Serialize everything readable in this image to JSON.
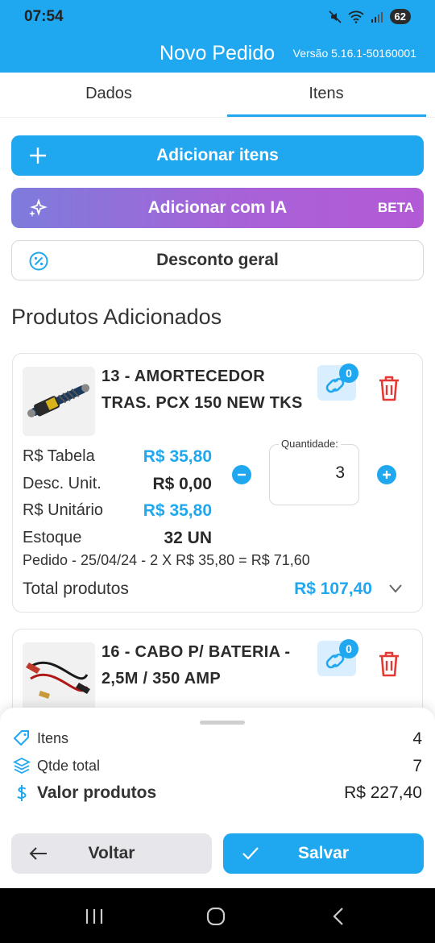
{
  "status": {
    "time": "07:54",
    "battery": "62"
  },
  "app": {
    "title": "Novo Pedido",
    "version": "Versão 5.16.1-50160001"
  },
  "tabs": [
    {
      "label": "Dados"
    },
    {
      "label": "Itens"
    }
  ],
  "actions": {
    "add_items": "Adicionar itens",
    "add_ai": "Adicionar com IA",
    "beta": "BETA",
    "discount": "Desconto geral"
  },
  "section_title": "Produtos Adicionados",
  "products": [
    {
      "name": "13 - AMORTECEDOR TRAS. PCX 150 NEW TKS",
      "link_count": "0",
      "rows": [
        {
          "label": "R$ Tabela",
          "value": "R$ 35,80"
        },
        {
          "label": "Desc. Unit.",
          "value": "R$ 0,00"
        },
        {
          "label": "R$ Unitário",
          "value": "R$ 35,80"
        },
        {
          "label": "Estoque",
          "value": "32 UN"
        }
      ],
      "quantity_label": "Quantidade:",
      "quantity": "3",
      "history": "Pedido - 25/04/24 - 2 X R$ 35,80 = R$ 71,60",
      "total_label": "Total produtos",
      "total_value": "R$ 107,40"
    },
    {
      "name": "16 - CABO P/ BATERIA - 2,5M / 350 AMP",
      "link_count": "0"
    }
  ],
  "summary": {
    "items_label": "Itens",
    "items_value": "4",
    "qty_label": "Qtde total",
    "qty_value": "7",
    "value_label": "Valor produtos",
    "value_value": "R$ 227,40"
  },
  "footer": {
    "back": "Voltar",
    "save": "Salvar"
  },
  "colors": {
    "primary": "#1fa7f0",
    "danger": "#e53935",
    "ai_gradient_start": "#7d7cdc",
    "ai_gradient_end": "#b35ad6"
  }
}
